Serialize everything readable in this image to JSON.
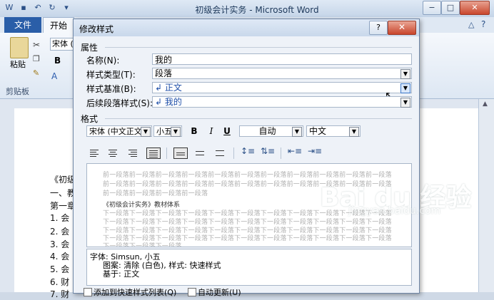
{
  "window": {
    "title": "初级会计实务 - Microsoft Word",
    "minimize": "−",
    "maximize": "□",
    "close": "✕"
  },
  "ribbon": {
    "tab_file": "文件",
    "tab_home": "开始",
    "paste": "粘贴",
    "clipboard": "剪贴板",
    "font_name": "宋体 (",
    "bold": "B",
    "text_effect": "A"
  },
  "document": {
    "lines": [
      "《初级",
      "一、教",
      "第一章",
      "1.  会",
      "2.  会",
      "3.  会",
      "4.  会",
      "5.  会",
      "6.  财",
      "7.  财"
    ]
  },
  "dialog": {
    "title": "修改样式",
    "help": "?",
    "close": "✕",
    "properties_section": "属性",
    "labels": {
      "name": "名称(N):",
      "style_type": "样式类型(T):",
      "based_on": "样式基准(B):",
      "next_style": "后续段落样式(S):"
    },
    "values": {
      "name": "我的",
      "style_type": "段落",
      "based_on": "↲ 正文",
      "next_style": "↲ 我的"
    },
    "format_section": "格式",
    "font": "宋体 (中文正文",
    "size": "小五",
    "bold": "B",
    "italic": "I",
    "underline": "U",
    "color": "自动",
    "language": "中文",
    "preview_prev_lines": [
      "前一段落前一段落前一段落前一段落前一段落前一段落前一段落前一段落前一段落前一段落前一段落",
      "前一段落前一段落前一段落前一段落前一段落前一段落前一段落前一段落前一段落前一段落前一段落",
      "前一段落前一段落前一段落前一段落"
    ],
    "preview_sample": "《初级会计实务》教材体系",
    "preview_next_lines": [
      "下一段落下一段落下一段落下一段落下一段落下一段落下一段落下一段落下一段落下一段落下一段落",
      "下一段落下一段落下一段落下一段落下一段落下一段落下一段落下一段落下一段落下一段落下一段落",
      "下一段落下一段落下一段落下一段落下一段落下一段落下一段落下一段落下一段落下一段落下一段落",
      "下一段落下一段落下一段落下一段落下一段落下一段落下一段落下一段落下一段落下一段落下一段落",
      "下一段落下一段落下一段落"
    ],
    "description": [
      "字体: Simsun, 小五",
      "图案: 清除 (白色), 样式: 快速样式",
      "基于: 正文"
    ],
    "add_to_quick": "添加到快速样式列表(Q)",
    "auto_update": "自动更新(U)"
  },
  "watermark": {
    "brand": "Bai du 经验",
    "url": "jingyan.baidu.com"
  },
  "colors": {
    "accent": "#2a5ea8",
    "dialog_bg": "#eef2f8",
    "close_red": "#c8452c"
  }
}
